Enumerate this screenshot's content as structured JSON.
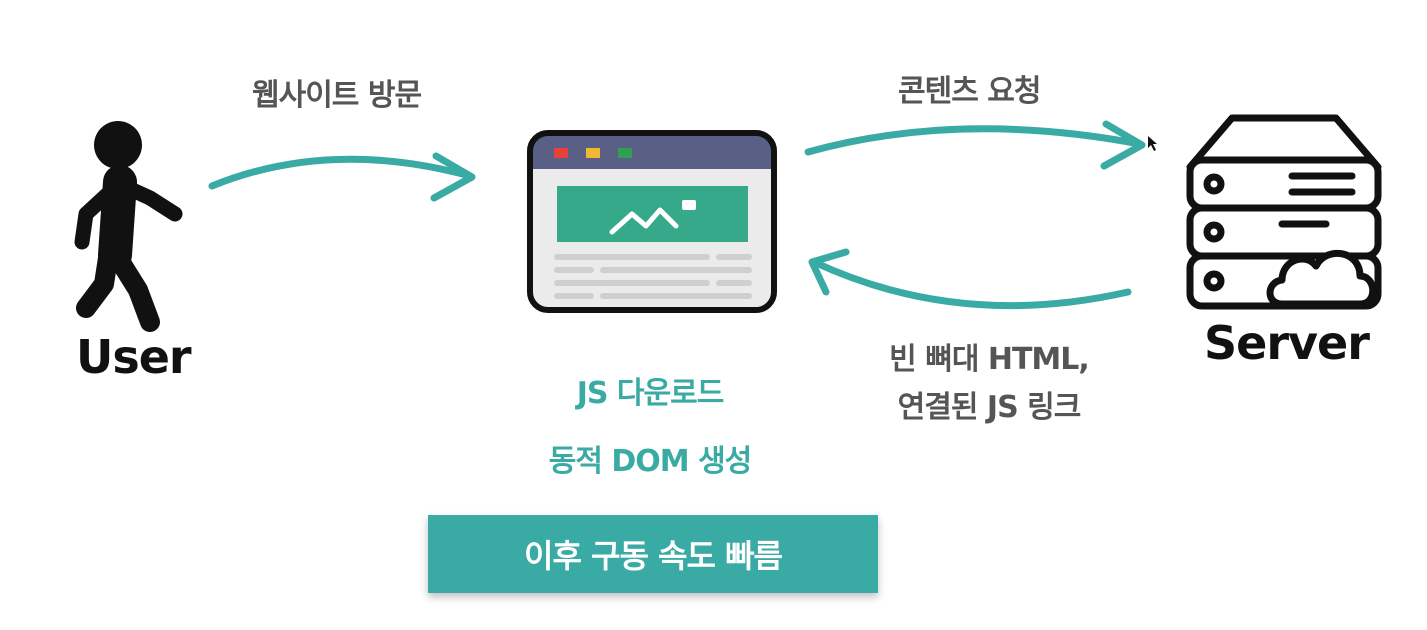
{
  "user": {
    "name": "User"
  },
  "server": {
    "name": "Server"
  },
  "arrows": {
    "visit": "웹사이트 방문",
    "request": "콘텐츠 요청",
    "response_line1": "빈 뼈대 HTML,",
    "response_line2": "연결된 JS 링크"
  },
  "browser_steps": {
    "step1": "JS 다운로드",
    "step2": "동적 DOM 생성"
  },
  "banner": {
    "text": "이후 구동 속도 빠름"
  },
  "colors": {
    "teal": "#3aaaa4",
    "browser_bar": "#5a5f85",
    "browser_hero": "#35a98a",
    "dot_red": "#e8413a",
    "dot_yellow": "#f2b733",
    "dot_green": "#2e9f54"
  },
  "icons": [
    "walking-person-icon",
    "browser-window-icon",
    "server-rack-icon",
    "cloud-icon",
    "mountain-image-icon",
    "mouse-cursor-icon"
  ]
}
